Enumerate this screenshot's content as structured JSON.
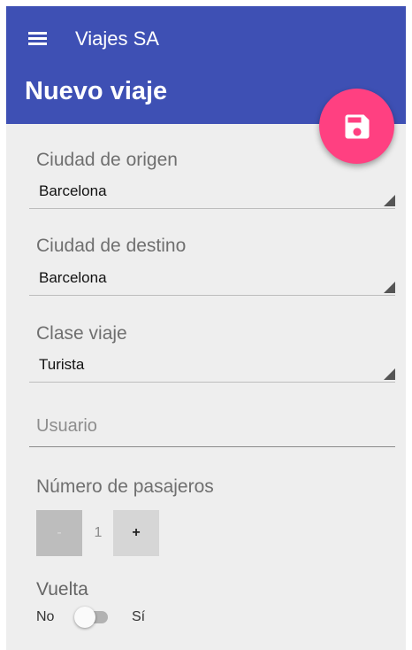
{
  "app": {
    "title": "Viajes SA",
    "page_title": "Nuevo viaje",
    "primary_color": "#3e50b4",
    "accent_color": "#ff4081",
    "background_color": "#eeeeee"
  },
  "toolbar": {
    "menu_icon": "menu-icon",
    "save_icon": "save-icon"
  },
  "form": {
    "origin": {
      "label": "Ciudad de origen",
      "value": "Barcelona"
    },
    "destination": {
      "label": "Ciudad de destino",
      "value": "Barcelona"
    },
    "class": {
      "label": "Clase viaje",
      "value": "Turista"
    },
    "user": {
      "placeholder": "Usuario",
      "value": ""
    },
    "passengers": {
      "label": "Número de pasajeros",
      "decrement": "-",
      "value": "1",
      "increment": "+"
    },
    "return": {
      "label": "Vuelta",
      "off_text": "No",
      "on_text": "Sí",
      "checked": false
    }
  }
}
